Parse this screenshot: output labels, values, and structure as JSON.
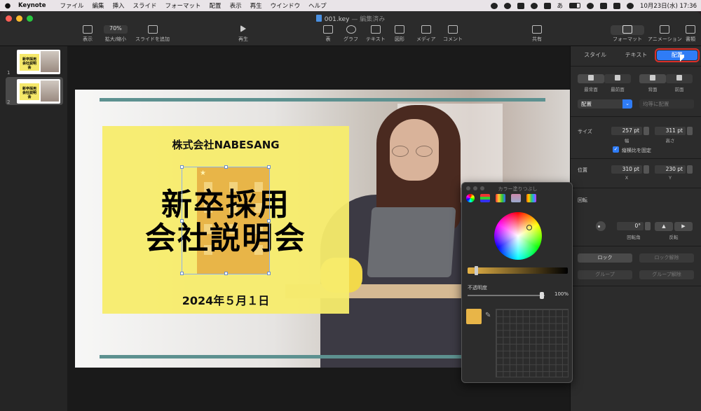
{
  "menubar": {
    "app": "Keynote",
    "items": [
      "ファイル",
      "編集",
      "挿入",
      "スライド",
      "フォーマット",
      "配置",
      "表示",
      "再生",
      "ウインドウ",
      "ヘルプ"
    ],
    "ime": "あ",
    "datetime": "10月23日(水) 17:36"
  },
  "window": {
    "doc_name": "001.key",
    "doc_status": "— 編集済み"
  },
  "toolbar": {
    "view": "表示",
    "zoom_value": "70%",
    "zoom": "拡大/縮小",
    "add_slide": "スライドを追加",
    "play": "再生",
    "table": "表",
    "chart": "グラフ",
    "text": "テキスト",
    "shape": "図形",
    "media": "メディア",
    "comment": "コメント",
    "share": "共有",
    "format": "フォーマット",
    "animation": "アニメーション",
    "document": "書類"
  },
  "slides": [
    {
      "num": "1",
      "thumb_title": "新卒採用 会社説明会"
    },
    {
      "num": "2",
      "thumb_title": "新卒採用 会社説明会"
    }
  ],
  "slide": {
    "company": "株式会社NABESANG",
    "headline_line1": "新卒採用",
    "headline_line2": "会社説明会",
    "date": "2024年５月１日"
  },
  "color_panel": {
    "title": "カラー塗りつぶし",
    "opacity_label": "不透明度",
    "opacity_value": "100%",
    "current_color": "#e8b548"
  },
  "inspector": {
    "tabs": [
      "スタイル",
      "テキスト",
      "配置"
    ],
    "active_tab": "配置",
    "layer": {
      "back": "最背面",
      "front": "最前面",
      "backward": "背面",
      "forward": "前面"
    },
    "align_select": "配置",
    "distribute_select": "均等に配置",
    "size_label": "サイズ",
    "width_value": "257 pt",
    "width_label": "幅",
    "height_value": "311 pt",
    "height_label": "高さ",
    "constrain_label": "縦横比を固定",
    "position_label": "位置",
    "x_value": "310 pt",
    "x_label": "X",
    "y_value": "230 pt",
    "y_label": "Y",
    "rotate_label": "回転",
    "angle_value": "0°",
    "angle_label": "回転角",
    "flip_label": "反転",
    "lock": "ロック",
    "unlock": "ロック解除",
    "group": "グループ",
    "ungroup": "グループ解除"
  }
}
